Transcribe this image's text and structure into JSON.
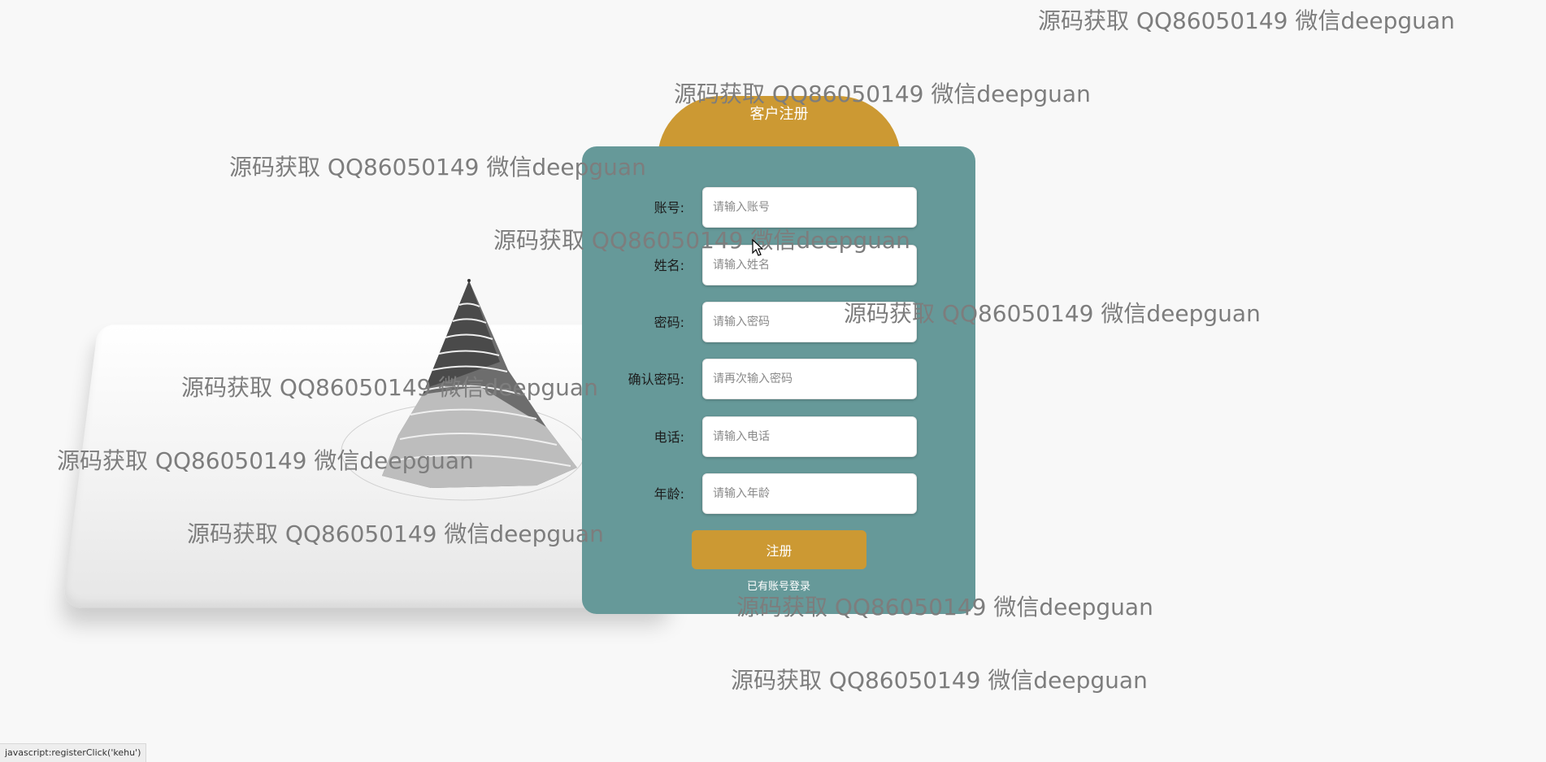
{
  "form": {
    "title": "客户注册",
    "fields": [
      {
        "label": "账号:",
        "placeholder": "请输入账号"
      },
      {
        "label": "姓名:",
        "placeholder": "请输入姓名"
      },
      {
        "label": "密码:",
        "placeholder": "请输入密码"
      },
      {
        "label": "确认密码:",
        "placeholder": "请再次输入密码"
      },
      {
        "label": "电话:",
        "placeholder": "请输入电话"
      },
      {
        "label": "年龄:",
        "placeholder": "请输入年龄"
      }
    ],
    "submit_label": "注册",
    "login_link": "已有账号登录"
  },
  "watermarks": [
    "源码获取 QQ86050149 微信deepguan",
    "源码获取 QQ86050149 微信deepguan",
    "源码获取 QQ86050149 微信deepguan",
    "源码获取 QQ86050149 微信deepguan",
    "源码获取 QQ86050149 微信deepguan",
    "源码获取 QQ86050149 微信deepguan",
    "源码获取 QQ86050149 微信deepguan",
    "源码获取 QQ86050149 微信deepguan",
    "源码获取 QQ86050149 微信deepguan",
    "源码获取 QQ86050149 微信deepguan"
  ],
  "status_bar": "javascript:registerClick('kehu')",
  "colors": {
    "panel": "#669999",
    "accent": "#cc9933",
    "background": "#f8f8f8"
  },
  "icons": [
    "cursor-arrow-icon"
  ]
}
